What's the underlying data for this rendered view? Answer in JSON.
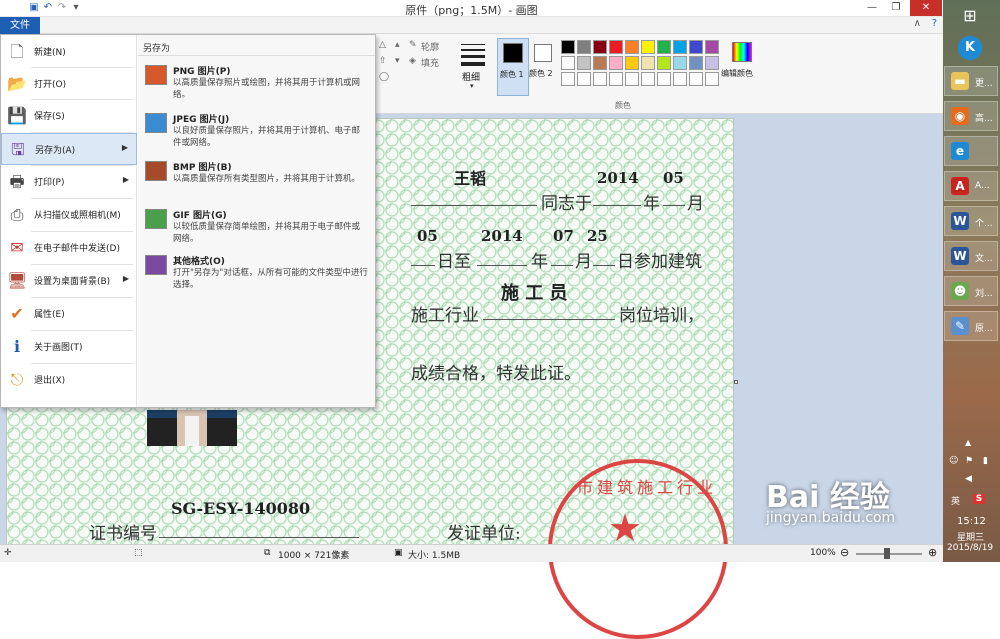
{
  "window": {
    "title": "原件（png；1.5M）- 画图"
  },
  "ribbon": {
    "file_tab": "文件",
    "outline_label": "轮廓",
    "fill_label": "填充",
    "size_label": "粗细",
    "color1_label": "颜色 1",
    "color2_label": "颜色 2",
    "edit_colors_label": "编辑颜色",
    "colors_group_label": "颜色",
    "palette_row1": [
      "#000000",
      "#7f7f7f",
      "#880015",
      "#ed1c24",
      "#ff7f27",
      "#fff200",
      "#22b14c",
      "#00a2e8",
      "#3f48cc",
      "#a349a4"
    ],
    "palette_row2": [
      "#ffffff",
      "#c3c3c3",
      "#b97a57",
      "#ffaec9",
      "#ffc90e",
      "#efe4b0",
      "#b5e61d",
      "#99d9ea",
      "#7092be",
      "#c8bfe7"
    ]
  },
  "file_menu": {
    "items": [
      {
        "label": "新建(N)",
        "icon": "new-file-icon"
      },
      {
        "label": "打开(O)",
        "icon": "open-folder-icon"
      },
      {
        "label": "保存(S)",
        "icon": "save-icon"
      },
      {
        "label": "另存为(A)",
        "icon": "save-as-icon",
        "submenu": true
      },
      {
        "label": "打印(P)",
        "icon": "printer-icon",
        "submenu": true
      },
      {
        "label": "从扫描仪或照相机(M)",
        "icon": "scanner-icon"
      },
      {
        "label": "在电子邮件中发送(D)",
        "icon": "email-icon"
      },
      {
        "label": "设置为桌面背景(B)",
        "icon": "desktop-icon",
        "submenu": true
      },
      {
        "label": "属性(E)",
        "icon": "checkmark-icon"
      },
      {
        "label": "关于画图(T)",
        "icon": "info-icon"
      },
      {
        "label": "退出(X)",
        "icon": "exit-icon"
      }
    ],
    "saveas_header": "另存为",
    "saveas_items": [
      {
        "title": "PNG 图片(P)",
        "desc": "以高质量保存照片或绘图，并将其用于计算机或网络。",
        "icon": "png-image-icon"
      },
      {
        "title": "JPEG 图片(J)",
        "desc": "以良好质量保存照片，并将其用于计算机、电子邮件或网络。",
        "icon": "jpeg-image-icon"
      },
      {
        "title": "BMP 图片(B)",
        "desc": "以高质量保存所有类型图片，并将其用于计算机。",
        "icon": "bmp-image-icon"
      },
      {
        "title": "GIF 图片(G)",
        "desc": "以较低质量保存简单绘图，并将其用于电子邮件或网络。",
        "icon": "gif-image-icon"
      },
      {
        "title": "其他格式(O)",
        "desc": "打开\"另存为\"对话框，从所有可能的文件类型中进行选择。",
        "icon": "other-format-icon"
      }
    ]
  },
  "certificate": {
    "name": "王韬",
    "year1": "2014",
    "month1": "05",
    "day1": "05",
    "year2": "2014",
    "month2": "07",
    "day2": "25",
    "line1_a": "同志于",
    "line1_b": "年",
    "line1_c": "月",
    "line2_a": "日至",
    "line2_b": "年",
    "line2_c": "月",
    "line2_d": "日参加建筑",
    "line3_a": "施工行业",
    "line3_role": "施 工 员",
    "line3_b": "岗位培训，",
    "line4": "成绩合格，特发此证。",
    "cert_no": "SG-ESY-140080",
    "cert_no_label": "证书编号",
    "issuer_label": "发证单位:",
    "seal_text": "市建筑施工行业"
  },
  "statusbar": {
    "dimensions": "1000 × 721像素",
    "size": "大小: 1.5MB",
    "zoom": "100%"
  },
  "taskbar": {
    "apps": [
      {
        "label": "更...",
        "icon": "folder-icon",
        "color": "#e8c45a"
      },
      {
        "label": "高...",
        "icon": "firefox-icon",
        "color": "#e66b1f"
      },
      {
        "label": "",
        "icon": "ie-icon",
        "color": "#1e8ad6"
      },
      {
        "label": "A...",
        "icon": "acrobat-icon",
        "color": "#c8231e"
      },
      {
        "label": "个...",
        "icon": "word-icon",
        "color": "#2b579a"
      },
      {
        "label": "文...",
        "icon": "word-icon",
        "color": "#2b579a"
      },
      {
        "label": "刘...",
        "icon": "photo-icon",
        "color": "#6aa84f"
      },
      {
        "label": "原...",
        "icon": "paint-icon",
        "color": "#5a8fd0"
      }
    ],
    "tray_lang": "英",
    "tray_s": "S",
    "time": "15:12",
    "weekday": "星期三",
    "date": "2015/8/19"
  },
  "watermark": {
    "brand": "Bai 经验",
    "url": "jingyan.baidu.com"
  }
}
